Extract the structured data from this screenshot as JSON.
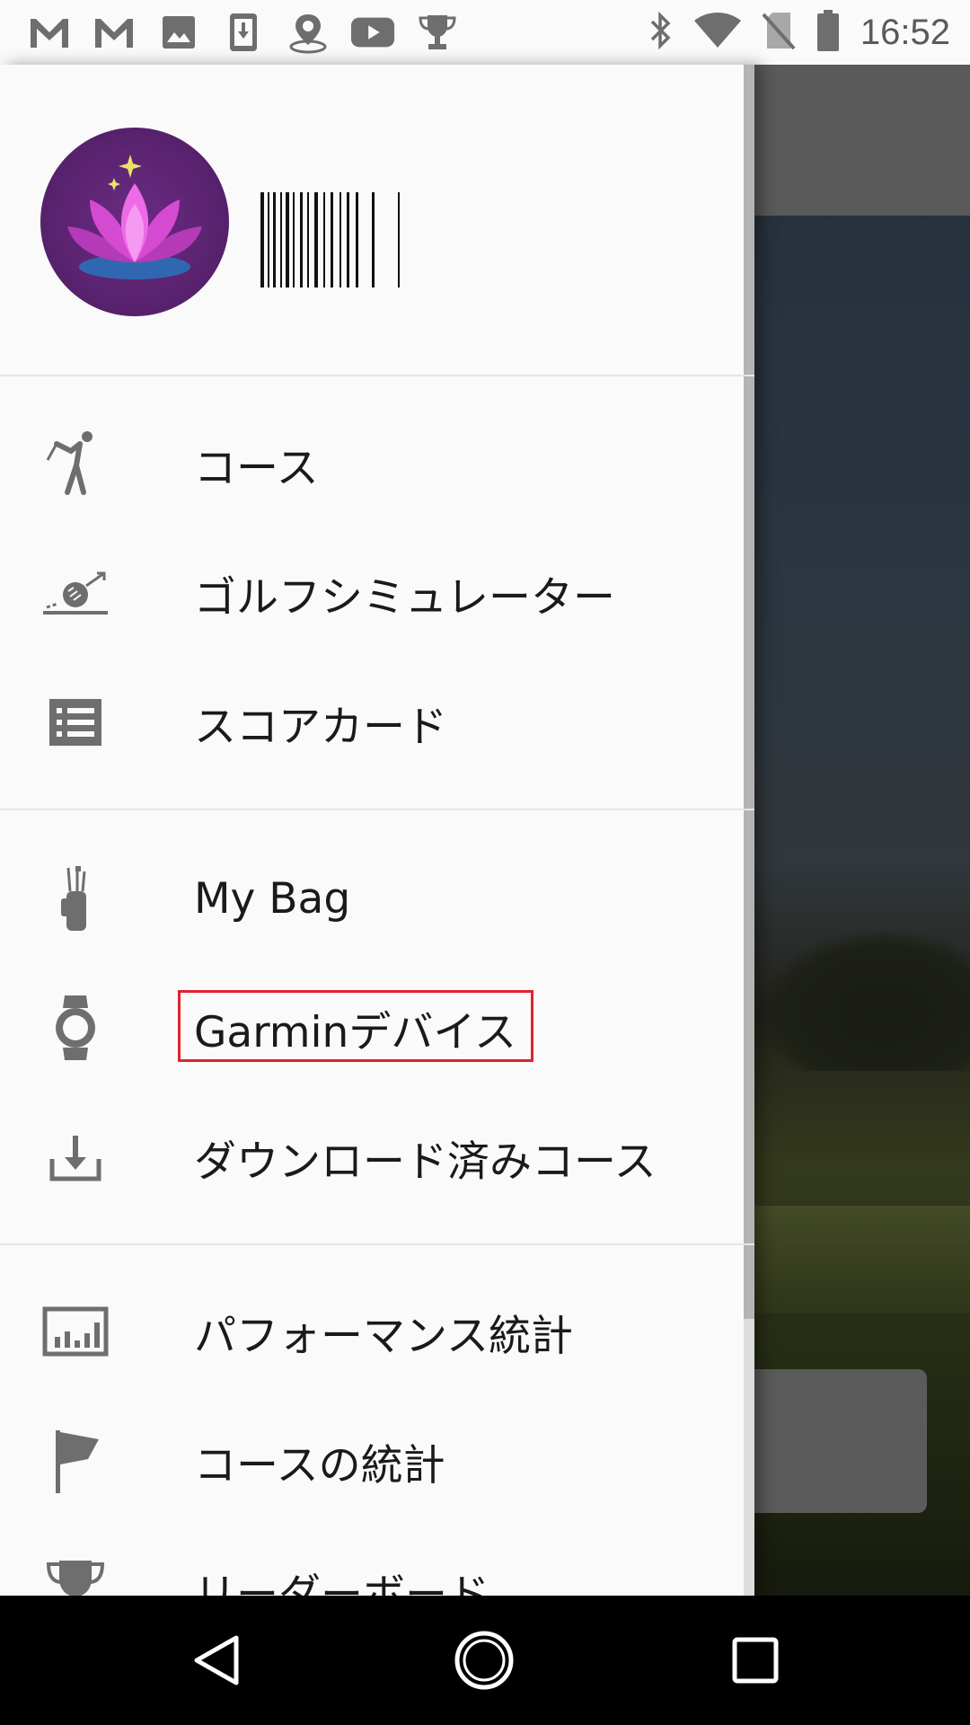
{
  "status_bar": {
    "time": "16:52",
    "left_icons": [
      "gmail-icon",
      "gmail-icon",
      "image-icon",
      "download-icon",
      "location-icon",
      "youtube-icon",
      "trophy-icon"
    ],
    "right_icons": [
      "bluetooth-icon",
      "wifi-icon",
      "no-sim-icon",
      "battery-icon"
    ]
  },
  "drawer": {
    "groups": [
      [
        {
          "icon": "golfer-icon",
          "label": "コース"
        },
        {
          "icon": "golf-simulator-icon",
          "label": "ゴルフシミュレーター"
        },
        {
          "icon": "scorecard-icon",
          "label": "スコアカード"
        }
      ],
      [
        {
          "icon": "golf-bag-icon",
          "label": "My Bag"
        },
        {
          "icon": "watch-icon",
          "label": "Garminデバイス"
        },
        {
          "icon": "download-icon",
          "label": "ダウンロード済みコース"
        }
      ],
      [
        {
          "icon": "bar-chart-icon",
          "label": "パフォーマンス統計"
        },
        {
          "icon": "flag-icon",
          "label": "コースの統計"
        },
        {
          "icon": "trophy-icon",
          "label": "リーダーボード"
        }
      ]
    ]
  },
  "nav_bar": {
    "buttons": [
      "back-icon",
      "home-icon",
      "recents-icon"
    ]
  },
  "colors": {
    "highlight_border": "#e0222e",
    "icon_gray": "#6e6e6e",
    "avatar_bg": "#5a2370"
  }
}
